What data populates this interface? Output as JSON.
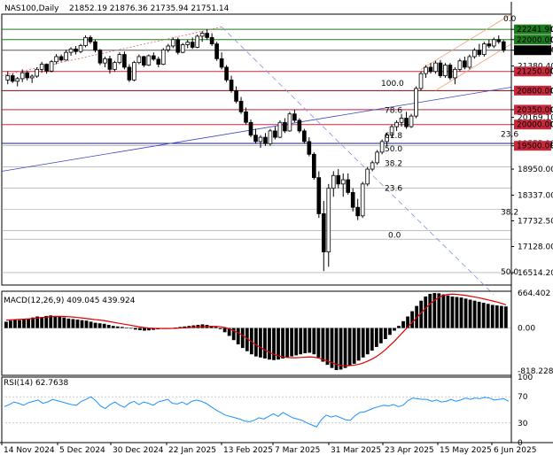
{
  "header": {
    "symbol": "NAS100,Daily",
    "ohlc": "21852.19 21876.36 21735.94 21751.14"
  },
  "chart_data": [
    {
      "type": "candlestick",
      "ylim": [
        16220,
        22600
      ],
      "price_ticks": [
        "22241.90",
        "22000.00",
        "21751.14",
        "21380.40",
        "21250.00",
        "20800.00",
        "20350.00",
        "20169.10",
        "20000.00",
        "19555.10",
        "19500.00",
        "18950.00",
        "18337.00",
        "17732.50",
        "17128.00",
        "16514.20"
      ],
      "badges": [
        {
          "value": "22241.90",
          "style": "green"
        },
        {
          "value": "22000.00",
          "style": "green"
        },
        {
          "value": "21751.14",
          "style": "black"
        },
        {
          "value": "21250.00",
          "style": "red"
        },
        {
          "value": "20800.00",
          "style": "red"
        },
        {
          "value": "20350.00",
          "style": "red"
        },
        {
          "value": "20000.00",
          "style": "red"
        },
        {
          "value": "19500.00",
          "style": "red"
        }
      ],
      "horizontal_levels": [
        {
          "price": 22241.9,
          "color": "#1e7a1e"
        },
        {
          "price": 22000.0,
          "color": "#1e7a1e"
        },
        {
          "price": 21751.14,
          "color": "#555555"
        },
        {
          "price": 21250.0,
          "color": "#c8283c"
        },
        {
          "price": 20800.0,
          "color": "#8b0a0a"
        },
        {
          "price": 20350.0,
          "color": "#c8283c"
        },
        {
          "price": 20000.0,
          "color": "#c8283c"
        },
        {
          "price": 19555.1,
          "color": "#1a1aa0"
        }
      ],
      "fib_labels": [
        {
          "label": "0.0",
          "price": 22390
        },
        {
          "label": "100.0",
          "price": 20870
        },
        {
          "label": "78.6",
          "price": 20230
        },
        {
          "label": "61.8",
          "price": 19640
        },
        {
          "label": "23.6",
          "price": 19670
        },
        {
          "label": "50.0",
          "price": 19330
        },
        {
          "label": "38.2",
          "price": 18980
        },
        {
          "label": "23.6",
          "price": 18400
        },
        {
          "label": "38.2",
          "price": 17840
        },
        {
          "label": "0.0",
          "price": 17290
        },
        {
          "label": "50.0",
          "price": 16430
        }
      ],
      "date_labels": [
        "14 Nov 2024",
        "5 Dec 2024",
        "30 Dec 2024",
        "22 Jan 2025",
        "13 Feb 2025",
        "7 Mar 2025",
        "31 Mar 2025",
        "23 Apr 2025",
        "15 May 2025",
        "6 Jun 2025"
      ],
      "candles": [
        [
          21050,
          21250,
          20950,
          21150
        ],
        [
          21150,
          21200,
          20980,
          21020
        ],
        [
          21020,
          21120,
          20900,
          21080
        ],
        [
          21080,
          21300,
          21000,
          21220
        ],
        [
          21220,
          21260,
          21040,
          21100
        ],
        [
          21100,
          21180,
          20980,
          21140
        ],
        [
          21140,
          21350,
          21100,
          21300
        ],
        [
          21300,
          21480,
          21220,
          21420
        ],
        [
          21420,
          21440,
          21200,
          21260
        ],
        [
          21260,
          21520,
          21230,
          21480
        ],
        [
          21480,
          21660,
          21420,
          21600
        ],
        [
          21600,
          21650,
          21480,
          21520
        ],
        [
          21520,
          21760,
          21500,
          21700
        ],
        [
          21700,
          21820,
          21620,
          21780
        ],
        [
          21780,
          21850,
          21650,
          21720
        ],
        [
          21720,
          21900,
          21680,
          21860
        ],
        [
          21860,
          22100,
          21820,
          22050
        ],
        [
          22050,
          22100,
          21900,
          21950
        ],
        [
          21950,
          22000,
          21700,
          21750
        ],
        [
          21750,
          21780,
          21400,
          21450
        ],
        [
          21450,
          21600,
          21350,
          21550
        ],
        [
          21550,
          21620,
          21200,
          21300
        ],
        [
          21300,
          21500,
          21250,
          21460
        ],
        [
          21460,
          21700,
          21420,
          21650
        ],
        [
          21650,
          21720,
          21300,
          21350
        ],
        [
          21350,
          21420,
          21000,
          21050
        ],
        [
          21050,
          21500,
          21020,
          21460
        ],
        [
          21460,
          21650,
          21420,
          21600
        ],
        [
          21600,
          21620,
          21350,
          21400
        ],
        [
          21400,
          21650,
          21380,
          21620
        ],
        [
          21620,
          21700,
          21500,
          21540
        ],
        [
          21540,
          21600,
          21350,
          21420
        ],
        [
          21420,
          21800,
          21400,
          21760
        ],
        [
          21760,
          21900,
          21700,
          21850
        ],
        [
          21850,
          22050,
          21800,
          22000
        ],
        [
          22000,
          22050,
          21650,
          21700
        ],
        [
          21700,
          21920,
          21680,
          21880
        ],
        [
          21880,
          22000,
          21800,
          21940
        ],
        [
          21940,
          22050,
          21780,
          21820
        ],
        [
          21820,
          22120,
          21800,
          22080
        ],
        [
          22080,
          22200,
          21950,
          22150
        ],
        [
          22150,
          22240,
          22000,
          22050
        ],
        [
          22050,
          22150,
          21850,
          21900
        ],
        [
          21900,
          21950,
          21500,
          21550
        ],
        [
          21550,
          21700,
          21300,
          21350
        ],
        [
          21350,
          21400,
          21000,
          21050
        ],
        [
          21050,
          21150,
          20750,
          20800
        ],
        [
          20800,
          20900,
          20500,
          20550
        ],
        [
          20550,
          20650,
          20250,
          20300
        ],
        [
          20300,
          20400,
          20000,
          20050
        ],
        [
          20050,
          20120,
          19700,
          19750
        ],
        [
          19750,
          19900,
          19550,
          19600
        ],
        [
          19600,
          19750,
          19450,
          19700
        ],
        [
          19700,
          19800,
          19500,
          19550
        ],
        [
          19550,
          19900,
          19500,
          19850
        ],
        [
          19850,
          19950,
          19650,
          19700
        ],
        [
          19700,
          20100,
          19680,
          20050
        ],
        [
          20050,
          20150,
          19800,
          19850
        ],
        [
          19850,
          20300,
          19830,
          20250
        ],
        [
          20250,
          20350,
          20050,
          20100
        ],
        [
          20100,
          20150,
          19800,
          19850
        ],
        [
          19850,
          19900,
          19550,
          19600
        ],
        [
          19600,
          19700,
          19250,
          19300
        ],
        [
          19300,
          19350,
          18700,
          18750
        ],
        [
          18750,
          18900,
          17800,
          17900
        ],
        [
          17900,
          18200,
          16550,
          17000
        ],
        [
          17000,
          18600,
          16650,
          18500
        ],
        [
          18500,
          18900,
          18300,
          18800
        ],
        [
          18800,
          18950,
          18500,
          18600
        ],
        [
          18600,
          18850,
          18300,
          18700
        ],
        [
          18700,
          18850,
          18350,
          18400
        ],
        [
          18400,
          18500,
          17950,
          18050
        ],
        [
          18050,
          18250,
          17750,
          17850
        ],
        [
          17850,
          18650,
          17800,
          18600
        ],
        [
          18600,
          19000,
          18550,
          18950
        ],
        [
          18950,
          19150,
          18900,
          19100
        ],
        [
          19100,
          19400,
          19050,
          19350
        ],
        [
          19350,
          19650,
          19300,
          19600
        ],
        [
          19600,
          19800,
          19500,
          19750
        ],
        [
          19750,
          20000,
          19700,
          19950
        ],
        [
          19950,
          20100,
          19850,
          20050
        ],
        [
          20050,
          20250,
          19950,
          20150
        ],
        [
          20150,
          20300,
          19900,
          19950
        ],
        [
          19950,
          20250,
          19920,
          20200
        ],
        [
          20200,
          20900,
          20150,
          20850
        ],
        [
          20850,
          21250,
          20800,
          21200
        ],
        [
          21200,
          21400,
          21100,
          21350
        ],
        [
          21350,
          21450,
          21200,
          21250
        ],
        [
          21250,
          21500,
          21200,
          21450
        ],
        [
          21450,
          21520,
          21100,
          21150
        ],
        [
          21150,
          21450,
          21100,
          21400
        ],
        [
          21400,
          21450,
          21050,
          21100
        ],
        [
          21100,
          21350,
          20950,
          21300
        ],
        [
          21300,
          21550,
          21250,
          21500
        ],
        [
          21500,
          21600,
          21300,
          21350
        ],
        [
          21350,
          21650,
          21300,
          21600
        ],
        [
          21600,
          21800,
          21550,
          21750
        ],
        [
          21750,
          21900,
          21600,
          21650
        ],
        [
          21650,
          21950,
          21600,
          21900
        ],
        [
          21900,
          22000,
          21800,
          21850
        ],
        [
          21850,
          22050,
          21800,
          22000
        ],
        [
          22000,
          22100,
          21900,
          21950
        ],
        [
          21950,
          21990,
          21700,
          21751
        ]
      ]
    },
    {
      "type": "bar",
      "title": "MACD(12,26,9) 409.045 439.924",
      "ylim": [
        -900,
        700
      ],
      "ticks": [
        "664.402",
        "0.00",
        "-818.228"
      ],
      "series": [
        {
          "values": [
            120,
            140,
            160,
            150,
            170,
            180,
            200,
            220,
            210,
            230,
            240,
            230,
            220,
            200,
            180,
            170,
            160,
            150,
            140,
            120,
            100,
            90,
            80,
            60,
            40,
            30,
            20,
            10,
            -10,
            -30,
            -40,
            -50,
            -45,
            -35,
            -25,
            -15,
            -5,
            0,
            10,
            20,
            30,
            40,
            50,
            60,
            70,
            60,
            40,
            20,
            -20,
            -80,
            -150,
            -230,
            -310,
            -380,
            -440,
            -500,
            -540,
            -560,
            -580,
            -600,
            -610,
            -600,
            -580,
            -560,
            -540,
            -520,
            -500,
            -480,
            -470,
            -500,
            -560,
            -640,
            -700,
            -760,
            -800,
            -790,
            -760,
            -720,
            -680,
            -620,
            -560,
            -500,
            -430,
            -360,
            -290,
            -210,
            -130,
            -50,
            40,
            130,
            220,
            320,
            420,
            520,
            600,
            650,
            665,
            660,
            640,
            620,
            600,
            590,
            580,
            560,
            540,
            520,
            500,
            480,
            460,
            440,
            430,
            420,
            410
          ]
        },
        {
          "name": "signal",
          "values": [
            150,
            155,
            160,
            165,
            170,
            175,
            180,
            190,
            200,
            210,
            215,
            220,
            222,
            220,
            215,
            210,
            200,
            190,
            180,
            170,
            160,
            150,
            140,
            125,
            110,
            95,
            80,
            65,
            50,
            35,
            20,
            8,
            0,
            -5,
            -8,
            -10,
            -10,
            -8,
            -5,
            0,
            5,
            10,
            15,
            20,
            25,
            28,
            30,
            30,
            25,
            10,
            -15,
            -50,
            -90,
            -140,
            -200,
            -260,
            -320,
            -370,
            -420,
            -460,
            -500,
            -530,
            -550,
            -560,
            -565,
            -565,
            -560,
            -555,
            -550,
            -555,
            -570,
            -600,
            -630,
            -660,
            -690,
            -710,
            -720,
            -715,
            -705,
            -690,
            -665,
            -630,
            -590,
            -540,
            -480,
            -410,
            -330,
            -250,
            -160,
            -70,
            20,
            110,
            200,
            290,
            380,
            460,
            530,
            585,
            620,
            640,
            645,
            640,
            630,
            620,
            605,
            590,
            575,
            555,
            535,
            515,
            495,
            470,
            440
          ]
        }
      ]
    },
    {
      "type": "line",
      "title": "RSI(14) 62.7638",
      "ylim": [
        0,
        100
      ],
      "ticks": [
        "100",
        "70",
        "30",
        "0"
      ],
      "values": [
        55,
        58,
        62,
        60,
        57,
        61,
        63,
        65,
        60,
        62,
        66,
        64,
        62,
        60,
        58,
        57,
        63,
        66,
        70,
        64,
        56,
        52,
        58,
        62,
        57,
        54,
        60,
        63,
        58,
        62,
        60,
        57,
        62,
        64,
        66,
        60,
        59,
        62,
        58,
        63,
        65,
        63,
        60,
        55,
        50,
        46,
        42,
        40,
        38,
        36,
        33,
        32,
        34,
        38,
        36,
        40,
        44,
        40,
        46,
        42,
        38,
        36,
        34,
        30,
        27,
        24,
        35,
        42,
        39,
        41,
        38,
        35,
        34,
        41,
        46,
        47,
        50,
        53,
        55,
        57,
        56,
        58,
        55,
        57,
        64,
        68,
        67,
        66,
        66,
        63,
        65,
        62,
        63,
        66,
        63,
        65,
        68,
        66,
        68,
        67,
        69,
        68,
        65,
        66,
        67,
        63
      ]
    }
  ]
}
